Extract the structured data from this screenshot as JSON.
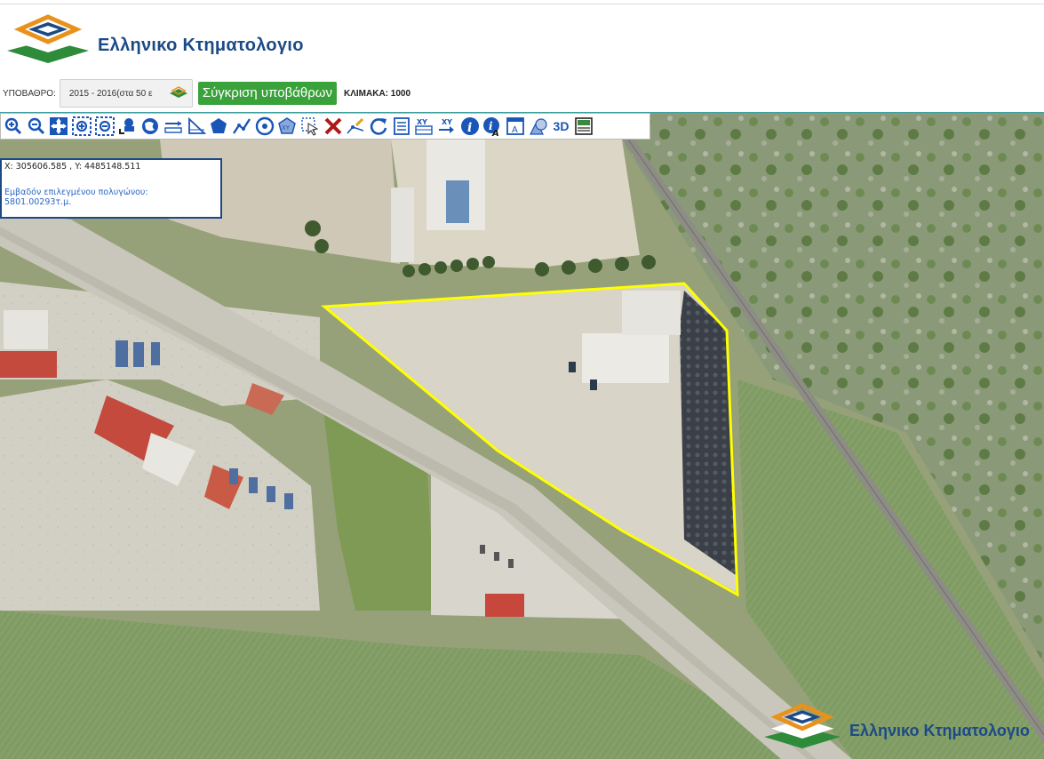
{
  "header": {
    "logo_text": "Ελληνικο Κτηματολογιο"
  },
  "controls": {
    "basemap_label": "ΥΠΟΒΑΘΡΟ:",
    "basemap_value": "2015 - 2016(στα 50 ε",
    "compare_button": "Σύγκριση υποβάθρων",
    "scale_text": "ΚΛΙΜΑΚΑ: 1000"
  },
  "toolbar": {
    "tools": [
      {
        "name": "zoom-in-icon"
      },
      {
        "name": "zoom-out-icon"
      },
      {
        "name": "pan-icon"
      },
      {
        "name": "zoom-box-in-icon"
      },
      {
        "name": "zoom-box-out-icon"
      },
      {
        "name": "previous-extent-icon"
      },
      {
        "name": "full-extent-icon"
      },
      {
        "name": "measure-distance-icon"
      },
      {
        "name": "measure-ruler-icon"
      },
      {
        "name": "measure-area-icon"
      },
      {
        "name": "polyline-icon"
      },
      {
        "name": "circle-target-icon"
      },
      {
        "name": "xy-polygon-icon"
      },
      {
        "name": "select-icon"
      },
      {
        "name": "clear-icon"
      },
      {
        "name": "edit-vertex-icon"
      },
      {
        "name": "refresh-icon"
      },
      {
        "name": "list-icon"
      },
      {
        "name": "xy-table-icon"
      },
      {
        "name": "xy-goto-icon"
      },
      {
        "name": "info-icon"
      },
      {
        "name": "info-text-icon"
      },
      {
        "name": "legend-icon"
      },
      {
        "name": "identify-shapes-icon"
      },
      {
        "name": "3d-icon",
        "label": "3D"
      },
      {
        "name": "print-icon"
      }
    ]
  },
  "coordinate_panel": {
    "coords": "X: 305606.585 , Y: 4485148.511",
    "area_label": "Εμβαδόν επιλεγμένου πολυγώνου:",
    "area_value": "5801.00293τ.μ."
  },
  "watermark": {
    "text": "Ελληνικο Κτηματολογιο"
  },
  "colors": {
    "brand_blue": "#1c4a86",
    "brand_green": "#3aa23a",
    "logo_orange": "#e8921c",
    "polygon_yellow": "#ffff00"
  }
}
